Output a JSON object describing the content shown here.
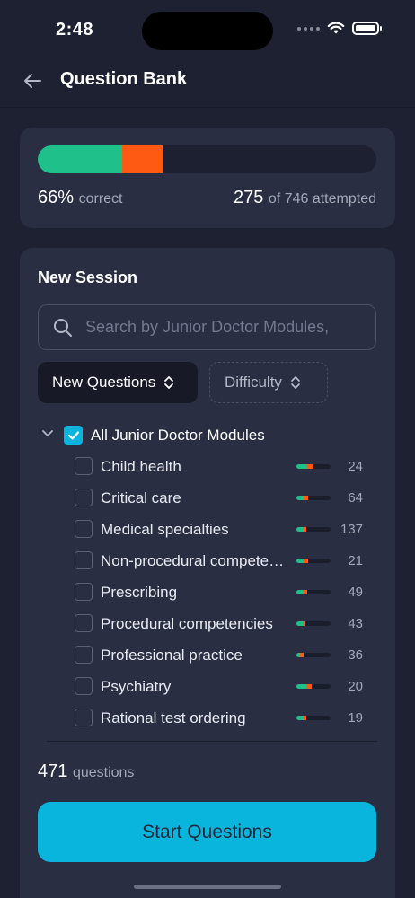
{
  "status_bar": {
    "time": "2:48"
  },
  "header": {
    "title": "Question Bank"
  },
  "stats": {
    "correct_fraction_of_attempted": 0.66,
    "incorrect_fraction_of_bar": 0.12,
    "attempted_fraction_of_bar": 0.37,
    "percent_value": "66%",
    "percent_label": "correct",
    "attempted_value": "275",
    "attempted_suffix": "of 746 attempted"
  },
  "session": {
    "title": "New Session",
    "search_placeholder": "Search by Junior Doctor Modules,",
    "filter_new_label": "New Questions",
    "filter_difficulty_label": "Difficulty",
    "all_modules_label": "All Junior Doctor Modules",
    "modules": [
      {
        "label": "Child health",
        "count": "24",
        "correct": 0.3,
        "incorrect": 0.2
      },
      {
        "label": "Critical care",
        "count": "64",
        "correct": 0.2,
        "incorrect": 0.15
      },
      {
        "label": "Medical specialties",
        "count": "137",
        "correct": 0.2,
        "incorrect": 0.1
      },
      {
        "label": "Non-procedural compete…",
        "count": "21",
        "correct": 0.2,
        "incorrect": 0.15
      },
      {
        "label": "Prescribing",
        "count": "49",
        "correct": 0.2,
        "incorrect": 0.12
      },
      {
        "label": "Procedural competencies",
        "count": "43",
        "correct": 0.18,
        "incorrect": 0.05
      },
      {
        "label": "Professional practice",
        "count": "36",
        "correct": 0.1,
        "incorrect": 0.12
      },
      {
        "label": "Psychiatry",
        "count": "20",
        "correct": 0.3,
        "incorrect": 0.15
      },
      {
        "label": "Rational test ordering",
        "count": "19",
        "correct": 0.2,
        "incorrect": 0.1
      }
    ],
    "questions_value": "471",
    "questions_label": "questions",
    "start_label": "Start Questions"
  },
  "colors": {
    "accent": "#0ab5dd",
    "correct": "#1fc08a",
    "incorrect": "#ff5a14",
    "background": "#1e2131",
    "card": "#2a2e42"
  },
  "icons": {
    "back": "arrow-left-icon",
    "search": "search-icon",
    "sort": "chevron-up-down-icon",
    "expand": "chevron-down-icon",
    "check": "checkmark-icon"
  }
}
